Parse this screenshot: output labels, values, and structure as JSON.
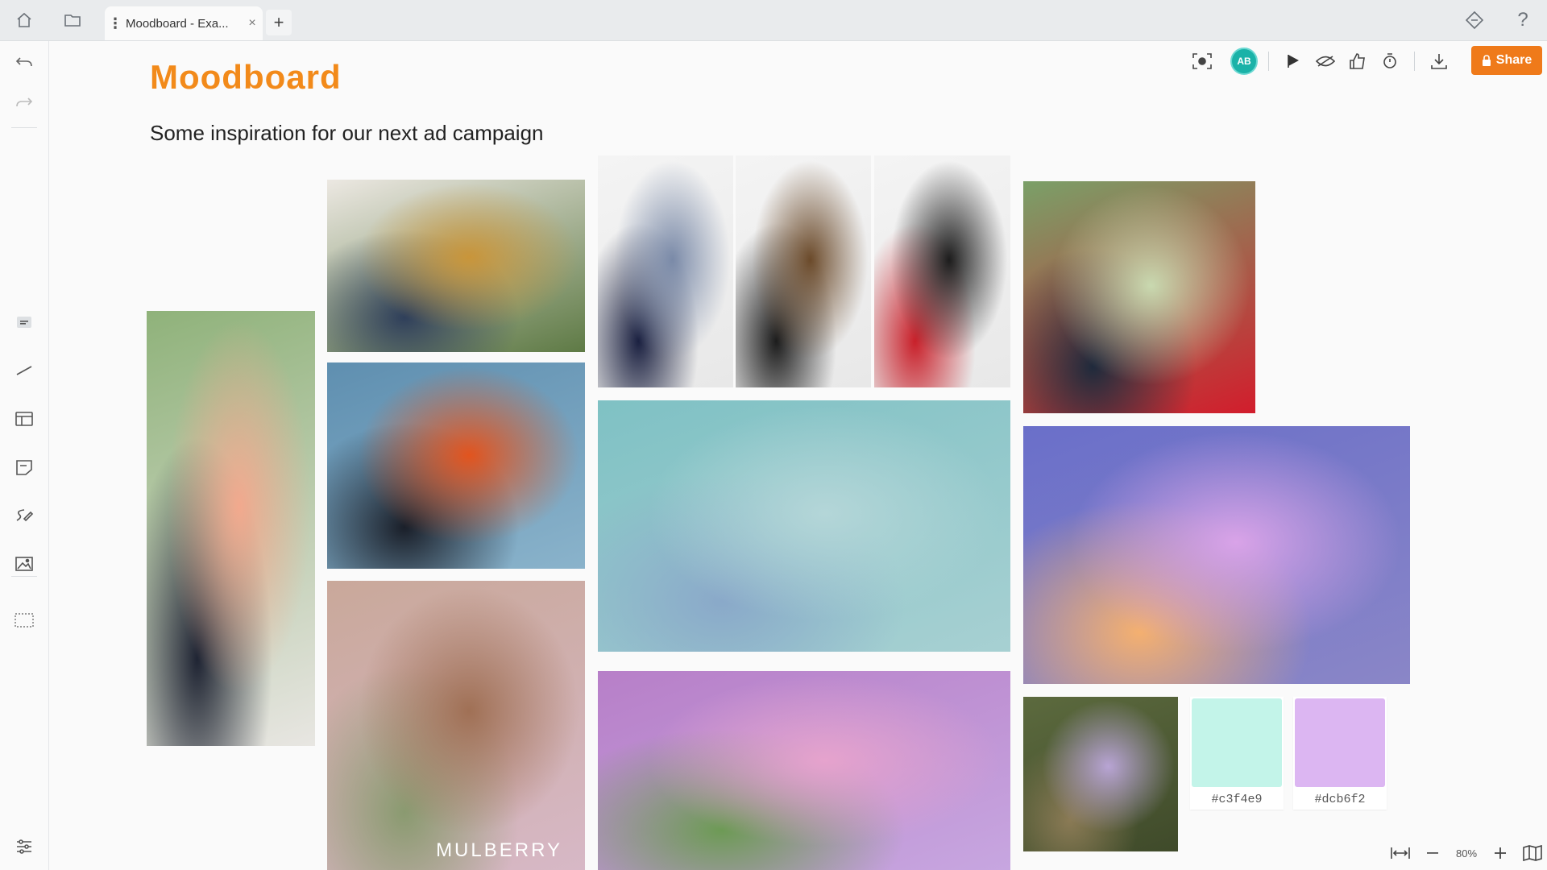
{
  "tabs": {
    "active_title": "Moodboard - Exa...",
    "close_glyph": "×",
    "new_tab_glyph": "+"
  },
  "board": {
    "title": "Moodboard",
    "subtitle": "Some inspiration for our next ad campaign"
  },
  "toolbar": {
    "avatar_initials": "AB",
    "share_label": "Share"
  },
  "images": [
    {
      "name": "photo-woman-pink-blazer",
      "colors": [
        "#8fb27a",
        "#f2a98e",
        "#1f2433",
        "#e8e6e2"
      ]
    },
    {
      "name": "photo-woman-sofa-green-bag",
      "colors": [
        "#ece8e2",
        "#c9953a",
        "#2f3f5a",
        "#5e7a45"
      ]
    },
    {
      "name": "photo-woman-orange-coat",
      "colors": [
        "#5f8fb0",
        "#e2541e",
        "#1a1f29",
        "#8ab3cb"
      ]
    },
    {
      "name": "photo-mulberry-garden",
      "colors": [
        "#c9a89a",
        "#a07055",
        "#8a9a70",
        "#d7b8c6"
      ],
      "caption": "MULBERRY"
    },
    {
      "name": "photo-lv-model-1",
      "colors": [
        "#f4f4f4",
        "#7a8aa8",
        "#1a2040",
        "#e8e8e8"
      ]
    },
    {
      "name": "photo-lv-model-2",
      "colors": [
        "#f4f4f4",
        "#6b4a2a",
        "#1c1c1c",
        "#e8e8e8"
      ]
    },
    {
      "name": "photo-lv-model-3",
      "colors": [
        "#f4f4f4",
        "#1c1c1c",
        "#c8202a",
        "#e8e8e8"
      ]
    },
    {
      "name": "photo-woman-denim-teal",
      "colors": [
        "#7fc1c4",
        "#b4d6d8",
        "#8aa9c9",
        "#a7d0d2"
      ]
    },
    {
      "name": "photo-hydrangea-girl",
      "colors": [
        "#b77fc8",
        "#e6a3cd",
        "#6d9a55",
        "#c7a6e0"
      ]
    },
    {
      "name": "photo-woman-red-bag-floral",
      "colors": [
        "#7aa068",
        "#c9d9b0",
        "#1f2a3c",
        "#d21d2c"
      ]
    },
    {
      "name": "photo-sunset-sea",
      "colors": [
        "#6a6fc9",
        "#d9a3e8",
        "#f4b070",
        "#8a86c7"
      ]
    },
    {
      "name": "photo-lilac-handbag",
      "colors": [
        "#5c6a3e",
        "#b8a4d4",
        "#8a7a55",
        "#3f4a2a"
      ]
    }
  ],
  "swatches": [
    {
      "hex_label": "#c3f4e9",
      "color": "#c3f4e9"
    },
    {
      "hex_label": "#dcb6f2",
      "color": "#dcb6f2"
    }
  ],
  "zoom": {
    "level": "80%"
  }
}
